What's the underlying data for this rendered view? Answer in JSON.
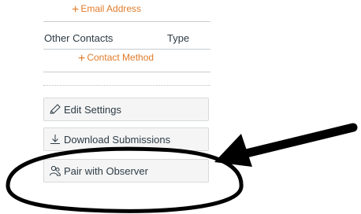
{
  "contact": {
    "add_email_label": "Email Address",
    "other_contacts_header": "Other Contacts",
    "type_header": "Type",
    "add_contact_method_label": "Contact Method"
  },
  "actions": {
    "edit_settings_label": "Edit Settings",
    "download_submissions_label": "Download Submissions",
    "pair_with_observer_label": "Pair with Observer"
  },
  "icons": {
    "add": "plus-icon",
    "edit": "pencil-icon",
    "download": "download-icon",
    "pair": "user-pair-icon"
  },
  "colors": {
    "accent": "#e07b2a",
    "annotation": "#000000"
  }
}
